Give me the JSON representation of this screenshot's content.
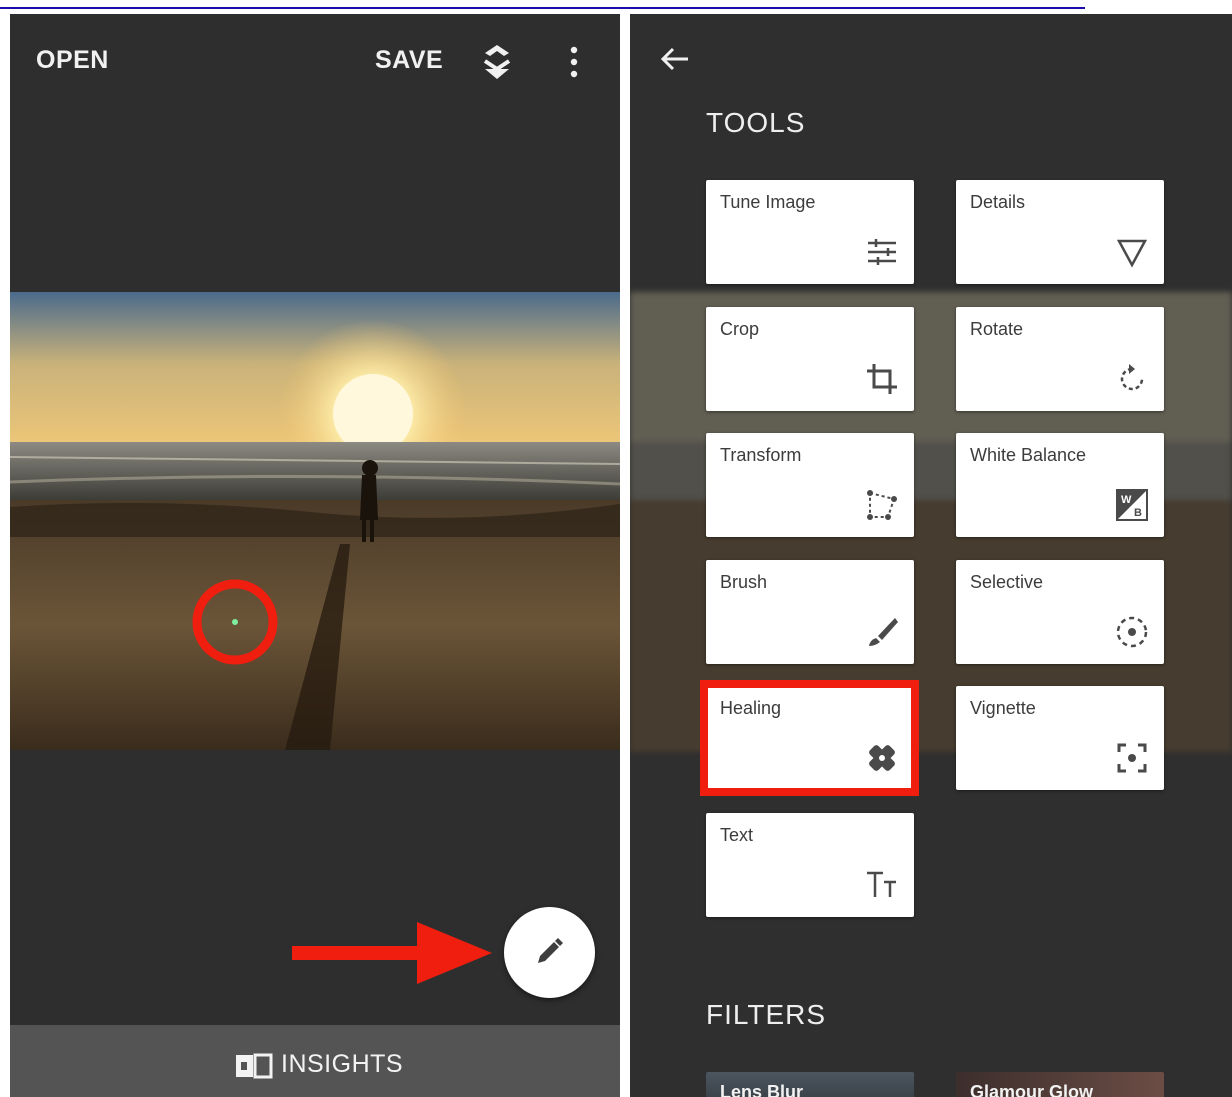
{
  "left_screen": {
    "toolbar": {
      "open_label": "OPEN",
      "save_label": "SAVE",
      "stack_icon": "layers-stack-icon",
      "menu_icon": "more-vertical-icon"
    },
    "fab_icon": "pencil-icon",
    "bottom_bar": {
      "insights_label": "INSIGHTS",
      "insights_icon": "insights-book-icon"
    },
    "annotations": {
      "circle_color": "#f01e0f",
      "arrow_color": "#f01e0f"
    }
  },
  "right_screen": {
    "back_icon": "arrow-left-icon",
    "tools_title": "TOOLS",
    "tools": [
      {
        "label": "Tune Image",
        "icon": "sliders-icon"
      },
      {
        "label": "Details",
        "icon": "triangle-down-icon"
      },
      {
        "label": "Crop",
        "icon": "crop-icon"
      },
      {
        "label": "Rotate",
        "icon": "rotate-icon"
      },
      {
        "label": "Transform",
        "icon": "transform-icon"
      },
      {
        "label": "White Balance",
        "icon": "white-balance-icon"
      },
      {
        "label": "Brush",
        "icon": "brush-icon"
      },
      {
        "label": "Selective",
        "icon": "selective-icon"
      },
      {
        "label": "Healing",
        "icon": "bandage-icon",
        "highlighted": true
      },
      {
        "label": "Vignette",
        "icon": "vignette-icon"
      },
      {
        "label": "Text",
        "icon": "text-icon"
      }
    ],
    "filters_title": "FILTERS",
    "filters": [
      {
        "label": "Lens Blur"
      },
      {
        "label": "Glamour Glow"
      }
    ]
  },
  "colors": {
    "panel_bg": "#2e2e2e",
    "highlight_red": "#f01e0f",
    "tile_bg": "#ffffff"
  }
}
